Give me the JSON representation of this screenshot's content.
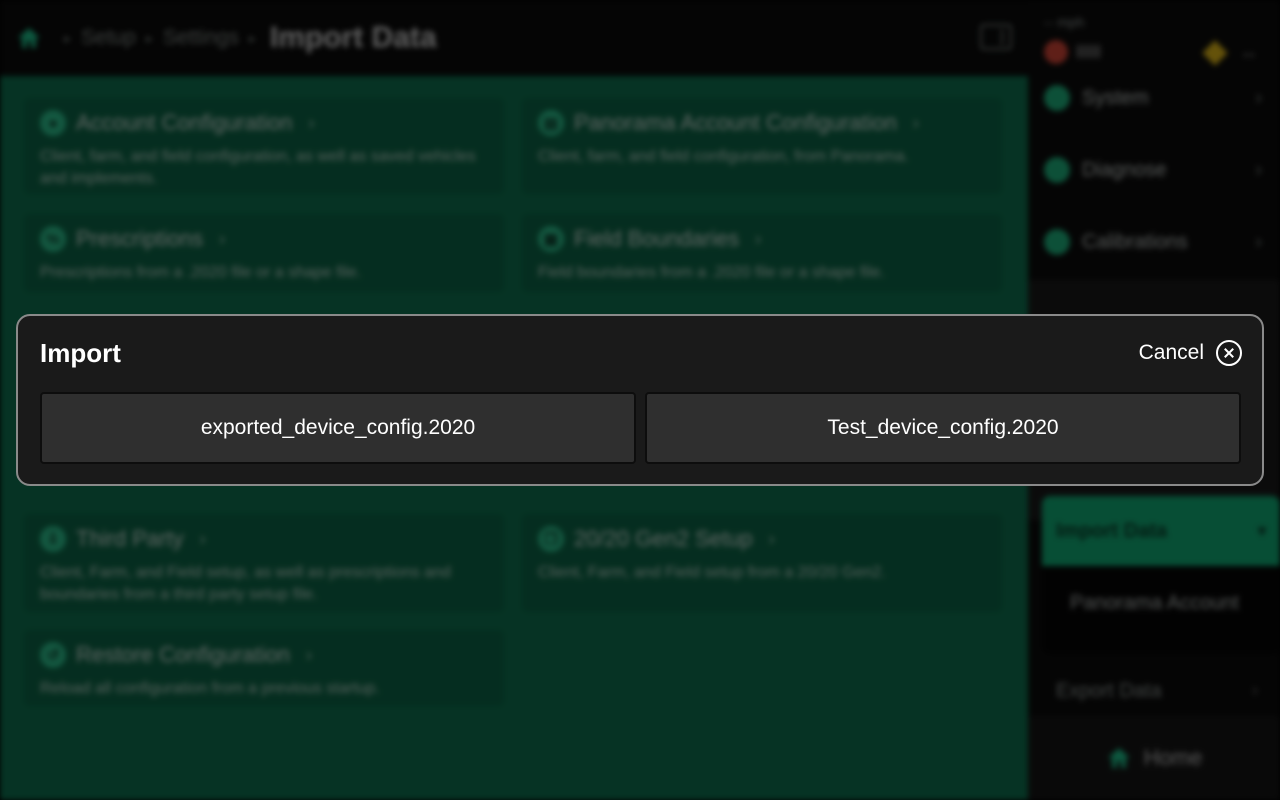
{
  "header": {
    "breadcrumbs": [
      "Setup",
      "Settings"
    ],
    "title": "Import Data"
  },
  "cards": [
    {
      "title": "Account Configuration",
      "description": "Client, farm, and field configuration, as well as saved vehicles and implements."
    },
    {
      "title": "Panorama Account Configuration",
      "description": "Client, farm, and field configuration, from Panorama."
    },
    {
      "title": "Prescriptions",
      "description": "Prescriptions from a .2020 file or a shape file."
    },
    {
      "title": "Field Boundaries",
      "description": "Field boundaries from a .2020 file or a shape file."
    },
    {
      "title": "Third Party",
      "description": "Client, Farm, and Field setup, as well as prescriptions and boundaries from a third party setup file."
    },
    {
      "title": "20/20 Gen2 Setup",
      "description": "Client, Farm, and Field setup from a 20/20 Gen2."
    },
    {
      "title": "Restore Configuration",
      "description": "Reload all configuration from a previous startup."
    }
  ],
  "status": {
    "speed": "-- mph",
    "signal": "IIIII"
  },
  "sidebar": {
    "items": [
      {
        "label": "System"
      },
      {
        "label": "Diagnose"
      },
      {
        "label": "Calibrations"
      }
    ],
    "import_data": "Import Data",
    "panorama_account": "Panorama Account",
    "export_data": "Export Data",
    "home": "Home"
  },
  "modal": {
    "title": "Import",
    "cancel_label": "Cancel",
    "files": [
      "exported_device_config.2020",
      "Test_device_config.2020"
    ]
  },
  "colors": {
    "accent": "#11b97e",
    "modal_bg": "#1a1a1a",
    "button_bg": "#2f2f2f"
  }
}
